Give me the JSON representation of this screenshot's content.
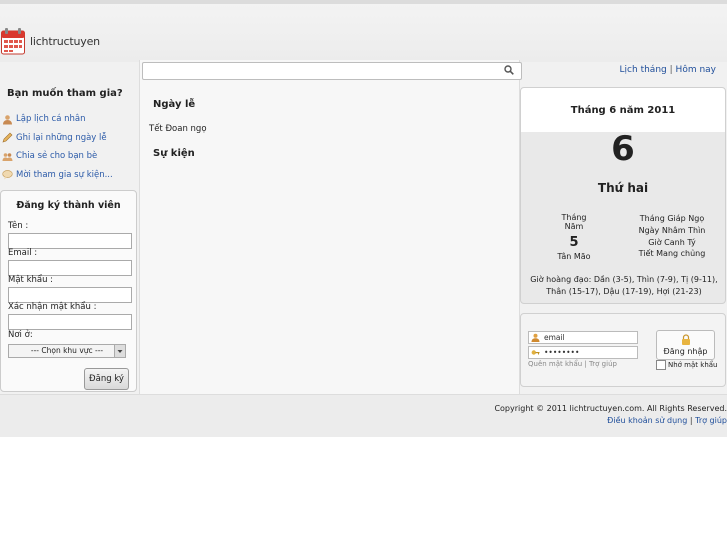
{
  "brand": {
    "name": "lichtructuyen"
  },
  "search": {
    "placeholder": ""
  },
  "toplinks": {
    "month": "Lịch tháng",
    "sep": "|",
    "today": "Hôm nay"
  },
  "sidebar": {
    "title": "Bạn muốn tham gia?",
    "links": [
      {
        "label": "Lập lịch cá nhân",
        "icon": "user-icon"
      },
      {
        "label": "Ghi lại những ngày lễ",
        "icon": "pencil-icon"
      },
      {
        "label": "Chia sẻ cho bạn bè",
        "icon": "users-icon"
      },
      {
        "label": "Mời tham gia sự kiện...",
        "icon": "chat-icon"
      }
    ]
  },
  "register": {
    "title": "Đăng ký thành viên",
    "name_label": "Tên :",
    "email_label": "Email :",
    "password_label": "Mật khẩu :",
    "confirm_label": "Xác nhận mật khẩu :",
    "location_label": "Nơi ở:",
    "location_selected": "--- Chọn khu vực ---",
    "submit": "Đăng ký"
  },
  "content": {
    "holidays_heading": "Ngày lễ",
    "holiday_item": "Tết Đoan ngọ",
    "events_heading": "Sự kiện"
  },
  "calendar": {
    "month_year": "Tháng 6 năm 2011",
    "day": "6",
    "weekday": "Thứ hai",
    "lunar_month_label": "Tháng Năm",
    "lunar_day": "5",
    "lunar_year": "Tân Mão",
    "can_chi_month": "Tháng Giáp Ngọ",
    "can_chi_day": "Ngày Nhâm Thìn",
    "can_chi_hour": "Giờ Canh Tý",
    "solar_term": "Tiết Mang chủng",
    "good_hours_1": "Giờ hoàng đạo: Dần (3-5), Thìn (7-9), Tị (9-11),",
    "good_hours_2": "Thân (15-17), Dậu (17-19), Hợi (21-23)"
  },
  "login": {
    "email_value": "email",
    "password_value": "••••••••",
    "forgot": "Quên mật khẩu",
    "sep": "|",
    "help": "Trợ giúp",
    "button": "Đăng nhập",
    "remember": "Nhớ mật khẩu"
  },
  "footer": {
    "copyright": "Copyright © 2011 lichtructuyen.com. All Rights Reserved.",
    "terms": "Điều khoản sử dụng",
    "sep": "|",
    "help": "Trợ giúp"
  },
  "colors": {
    "link": "#1f4e9a",
    "logo_red": "#d9382e"
  }
}
